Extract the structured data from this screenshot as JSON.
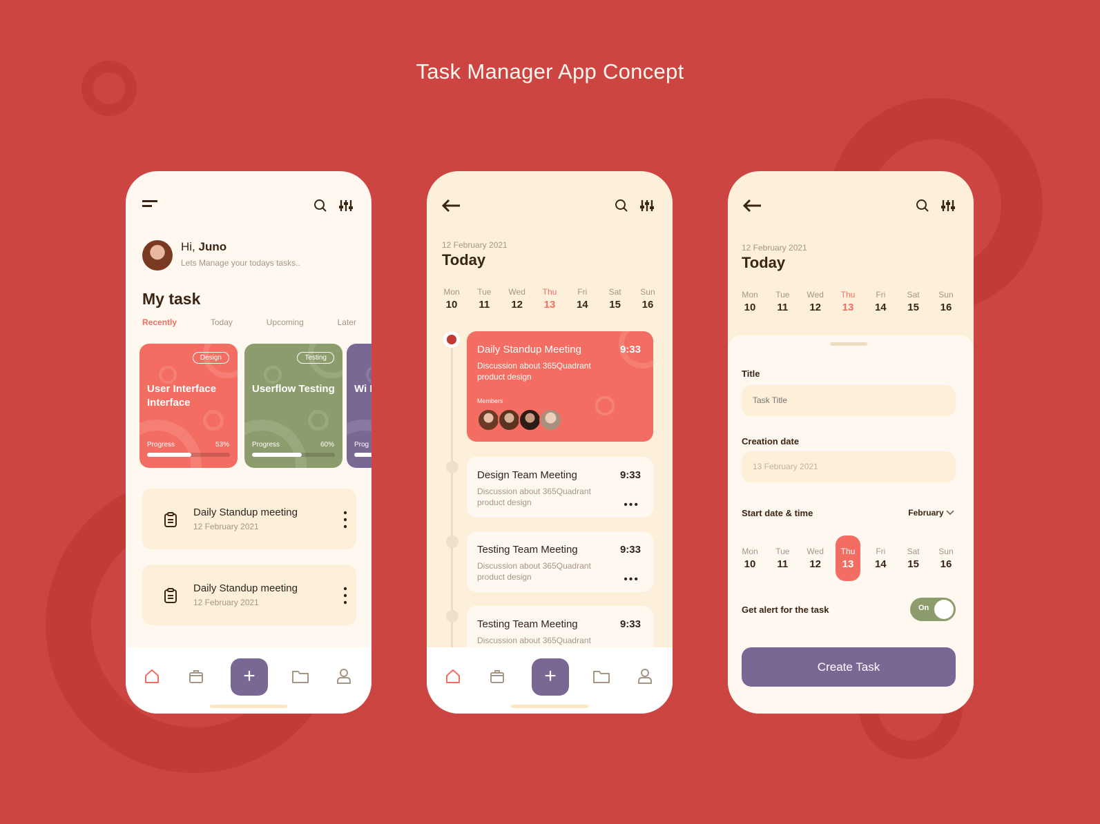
{
  "page_title": "Task Manager App Concept",
  "colors": {
    "background": "#cc4542",
    "coral": "#f46d62",
    "olive": "#8d9c6c",
    "purple": "#7a6894",
    "cream": "#fdf0da",
    "text": "#3a2414"
  },
  "home": {
    "greeting_prefix": "Hi,",
    "user_name": "Juno",
    "subtitle": "Lets Manage your todays tasks..",
    "section_title": "My task",
    "tabs": [
      {
        "label": "Recently",
        "active": true
      },
      {
        "label": "Today"
      },
      {
        "label": "Upcoming"
      },
      {
        "label": "Later"
      }
    ],
    "cards": [
      {
        "tag": "Design",
        "title": "User Interface Interface",
        "progress_label": "Progress",
        "progress_text": "53%",
        "progress": 0.53,
        "color": "#f46d62"
      },
      {
        "tag": "Testing",
        "title": "Userflow Testing",
        "progress_label": "Progress",
        "progress_text": "60%",
        "progress": 0.6,
        "color": "#8d9c6c"
      },
      {
        "tag": "",
        "title": "Wi Edi",
        "progress_label": "Prog",
        "progress_text": "",
        "progress": 0.3,
        "color": "#7a6894"
      }
    ],
    "tasks": [
      {
        "title": "Daily Standup meeting",
        "date": "12 February 2021"
      },
      {
        "title": "Daily Standup meeting",
        "date": "12 February 2021"
      }
    ]
  },
  "nav": {
    "icons": [
      "home-icon",
      "briefcase-icon",
      "plus-icon",
      "folder-icon",
      "user-icon"
    ],
    "plus": "+"
  },
  "schedule": {
    "date": "12 February 2021",
    "heading": "Today",
    "week": [
      {
        "name": "Mon",
        "num": "10"
      },
      {
        "name": "Tue",
        "num": "11"
      },
      {
        "name": "Wed",
        "num": "12"
      },
      {
        "name": "Thu",
        "num": "13",
        "highlight": true
      },
      {
        "name": "Fri",
        "num": "14"
      },
      {
        "name": "Sat",
        "num": "15"
      },
      {
        "name": "Sun",
        "num": "16"
      }
    ],
    "events": [
      {
        "title": "Daily Standup Meeting",
        "time": "9:33",
        "desc": "Discussion about 365Quadrant product design",
        "members_label": "Members",
        "active": true
      },
      {
        "title": "Design Team Meeting",
        "time": "9:33",
        "desc": "Discussion about 365Quadrant product design"
      },
      {
        "title": "Testing Team Meeting",
        "time": "9:33",
        "desc": "Discussion about 365Quadrant product design"
      },
      {
        "title": "Testing Team Meeting",
        "time": "9:33",
        "desc": "Discussion about 365Quadrant"
      }
    ]
  },
  "create": {
    "date": "12 February 2021",
    "heading": "Today",
    "title_label": "Title",
    "title_placeholder": "Task Title",
    "creation_label": "Creation date",
    "creation_value": "13 February 2021",
    "start_label": "Start date & time",
    "month": "February",
    "alert_label": "Get alert for the task",
    "alert_state": "On",
    "button": "Create Task"
  }
}
